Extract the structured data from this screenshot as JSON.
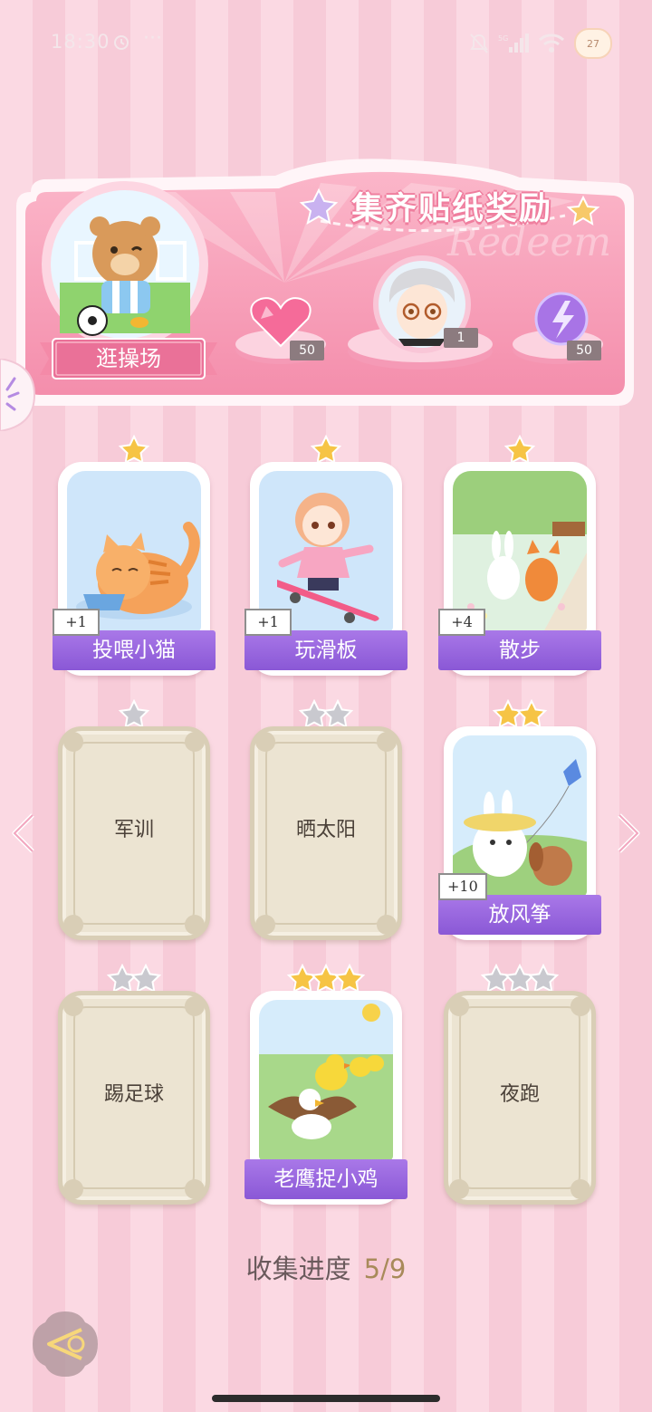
{
  "status_bar": {
    "time": "18:30",
    "dots": "···",
    "avatar_badge": "27"
  },
  "banner": {
    "title": "集齐贴纸奖励",
    "script_text": "Redeem",
    "playground_label": "逛操场",
    "rewards": [
      {
        "icon": "heart-gem-icon",
        "count": "50"
      },
      {
        "icon": "character-avatar",
        "count": "1"
      },
      {
        "icon": "lightning-orb-icon",
        "count": "50"
      }
    ]
  },
  "cards": [
    {
      "name": "投喂小猫",
      "stars": 1,
      "collected": true,
      "bonus": "+1",
      "art": "cat"
    },
    {
      "name": "玩滑板",
      "stars": 1,
      "collected": true,
      "bonus": "+1",
      "art": "skate"
    },
    {
      "name": "散步",
      "stars": 1,
      "collected": true,
      "bonus": "+4",
      "art": "walk"
    },
    {
      "name": "军训",
      "stars": 1,
      "collected": false
    },
    {
      "name": "晒太阳",
      "stars": 2,
      "collected": false
    },
    {
      "name": "放风筝",
      "stars": 2,
      "collected": true,
      "bonus": "+10",
      "art": "kite"
    },
    {
      "name": "踢足球",
      "stars": 2,
      "collected": false
    },
    {
      "name": "老鹰捉小鸡",
      "stars": 3,
      "collected": true,
      "bonus": "",
      "art": "eagle"
    },
    {
      "name": "夜跑",
      "stars": 3,
      "collected": false
    }
  ],
  "progress": {
    "label": "收集进度",
    "value": "5/9"
  },
  "colors": {
    "purple_label": "#9a68de",
    "star_gold": "#f6c445",
    "star_grey": "#c9c9cf",
    "pink_bg": "#fbd9e3"
  }
}
